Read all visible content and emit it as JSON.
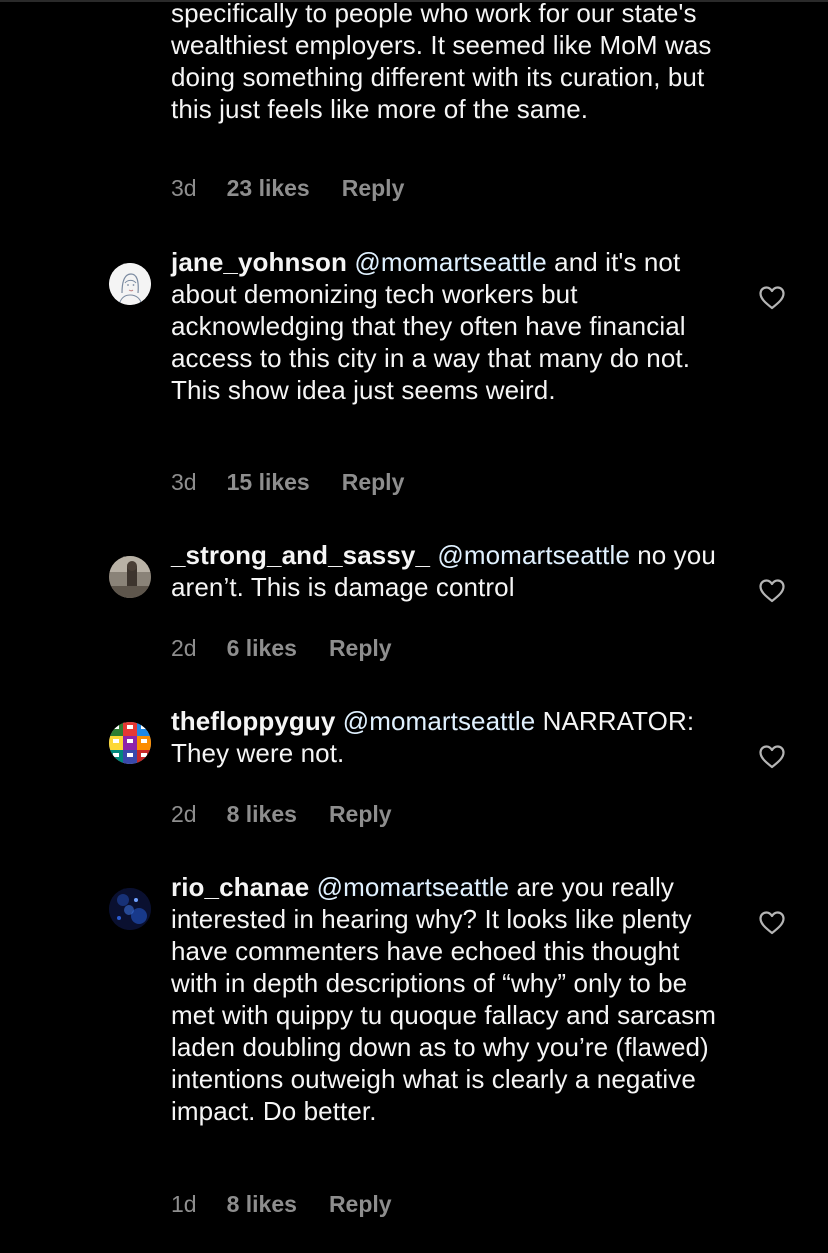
{
  "comments": [
    {
      "username": "",
      "mention": "",
      "text": "specifically to people who work for our state's wealthiest employers. It seemed like MoM was doing something different with its curation, but this just feels like more of the same.",
      "time": "3d",
      "likes": "23 likes",
      "reply": "Reply"
    },
    {
      "username": "jane_yohnson",
      "mention": "@momartseattle",
      "text": " and it's not about demonizing tech workers but acknowledging that they often have financial access to this city in a way that many do not. This show idea just seems weird.",
      "time": "3d",
      "likes": "15 likes",
      "reply": "Reply"
    },
    {
      "username": "_strong_and_sassy_",
      "mention": "@momartseattle",
      "text": " no you aren’t. This is damage control",
      "time": "2d",
      "likes": "6 likes",
      "reply": "Reply"
    },
    {
      "username": "thefloppyguy",
      "mention": "@momartseattle",
      "text": " NARRATOR: They were not.",
      "time": "2d",
      "likes": "8 likes",
      "reply": "Reply"
    },
    {
      "username": "rio_chanae",
      "mention": "@momartseattle",
      "text": " are you really interested in hearing why? It looks like plenty have commenters have echoed this thought with in depth descriptions of “why” only to be met with quippy tu quoque fallacy and sarcasm laden doubling down as to why you’re (flawed) intentions outweigh what is clearly a negative impact. Do better.",
      "time": "1d",
      "likes": "8 likes",
      "reply": "Reply"
    }
  ],
  "colors": {
    "background": "#000000",
    "text": "#f5f5f5",
    "mention": "#e0f1ff",
    "meta": "#8e8e8e"
  }
}
